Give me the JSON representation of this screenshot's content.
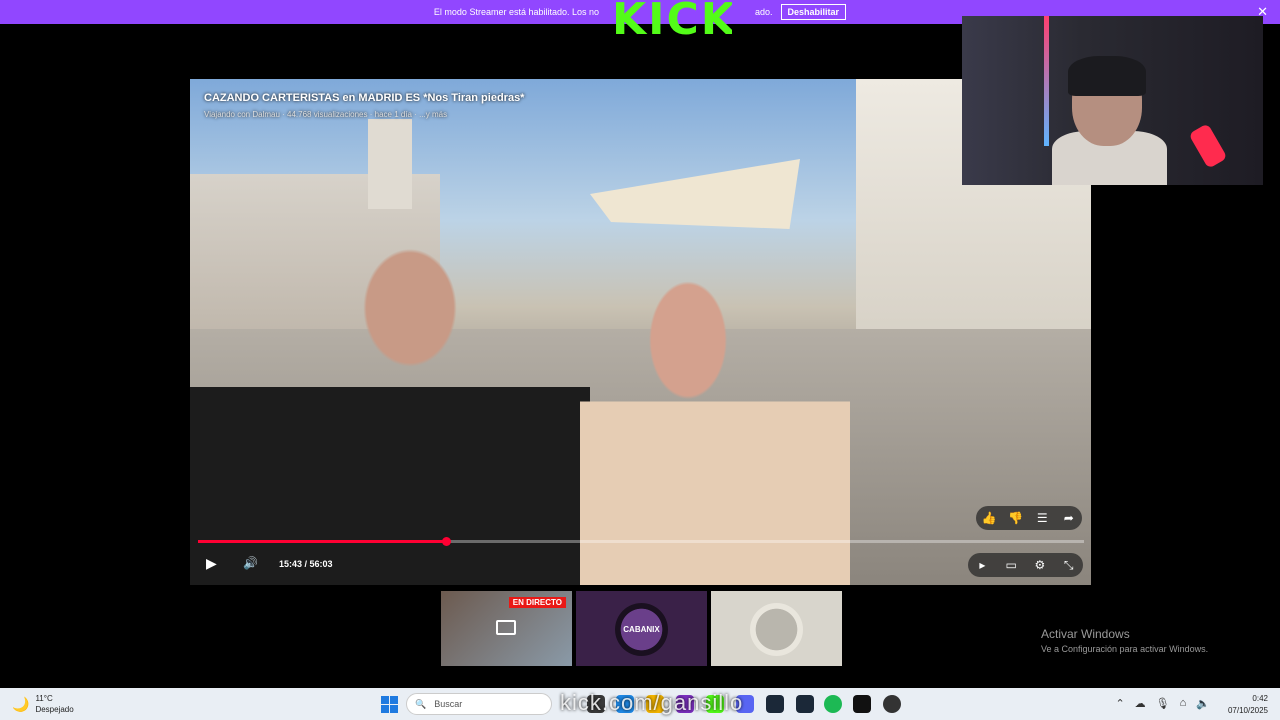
{
  "banner": {
    "text": "El modo Streamer está habilitado. Los no",
    "text_end": "ado.",
    "button_label": "Deshabilitar",
    "close": "✕"
  },
  "overlay": {
    "logo_text": "KICK",
    "url_text": "kick.com/gansillo"
  },
  "video": {
    "title": "CAZANDO CARTERISTAS en MADRID ES *Nos Tiran piedras*",
    "subtitle": "Viajando con Dalmau · 44.768 visualizaciones · hace 1 día · ...y más",
    "time_label": "15:43 / 56:03",
    "progress_fraction": 0.28,
    "progress_color": "#ff0033"
  },
  "thumbnails": [
    {
      "badge": "EN DIRECTO"
    },
    {
      "label": "CABANIX"
    },
    {}
  ],
  "activate_windows": {
    "title": "Activar Windows",
    "subtitle": "Ve a Configuración para activar Windows."
  },
  "taskbar": {
    "weather_temp": "11°C",
    "weather_desc": "Despejado",
    "search_placeholder": "Buscar",
    "clock_time": "0:42",
    "clock_date": "07/10/2025"
  },
  "colors": {
    "banner_bg": "#9147ff",
    "kick_green": "#53fc18",
    "live_red": "#e91916"
  }
}
